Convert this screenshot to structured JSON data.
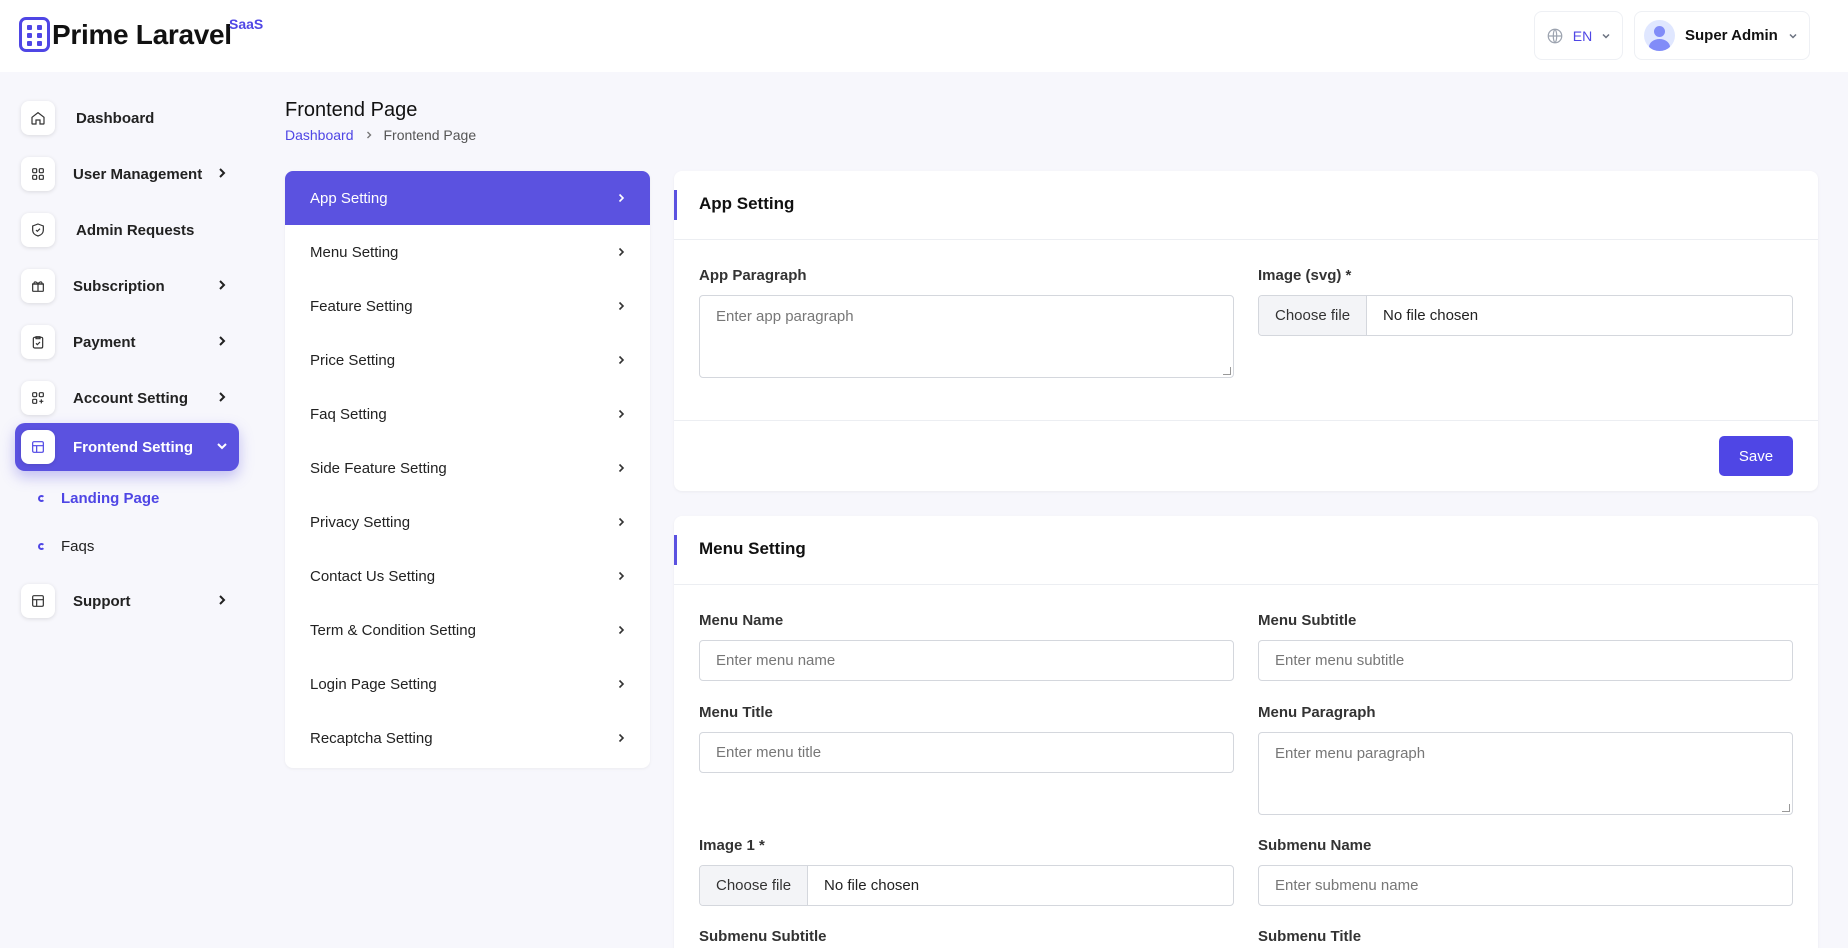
{
  "app": {
    "brand": "Prime Laravel",
    "brand_sup": "SaaS"
  },
  "header": {
    "language": "EN",
    "user_name": "Super Admin"
  },
  "sidebar": {
    "items": [
      {
        "label": "Dashboard",
        "icon": "home-icon"
      },
      {
        "label": "User Management",
        "icon": "grid-icon"
      },
      {
        "label": "Admin Requests",
        "icon": "shield-icon"
      },
      {
        "label": "Subscription",
        "icon": "gift-icon"
      },
      {
        "label": "Payment",
        "icon": "clipboard-icon"
      },
      {
        "label": "Account Setting",
        "icon": "apps-plus-icon"
      },
      {
        "label": "Frontend Setting",
        "icon": "layout-icon"
      },
      {
        "label": "Support",
        "icon": "layout-icon"
      }
    ],
    "sub_items": [
      "Landing Page",
      "Faqs"
    ]
  },
  "page": {
    "title": "Frontend Page",
    "breadcrumb": {
      "home": "Dashboard",
      "current": "Frontend Page"
    }
  },
  "settings_menu": [
    "App Setting",
    "Menu Setting",
    "Feature Setting",
    "Price Setting",
    "Faq Setting",
    "Side Feature Setting",
    "Privacy Setting",
    "Contact Us Setting",
    "Term & Condition Setting",
    "Login Page Setting",
    "Recaptcha Setting"
  ],
  "app_setting": {
    "title": "App Setting",
    "paragraph_label": "App Paragraph",
    "paragraph_placeholder": "Enter app paragraph",
    "image_label": "Image (svg) *",
    "choose_file": "Choose file",
    "no_file": "No file chosen",
    "save": "Save"
  },
  "menu_setting": {
    "title": "Menu Setting",
    "menu_name_label": "Menu Name",
    "menu_name_placeholder": "Enter menu name",
    "menu_subtitle_label": "Menu Subtitle",
    "menu_subtitle_placeholder": "Enter menu subtitle",
    "menu_title_label": "Menu Title",
    "menu_title_placeholder": "Enter menu title",
    "menu_paragraph_label": "Menu Paragraph",
    "menu_paragraph_placeholder": "Enter menu paragraph",
    "image1_label": "Image 1 *",
    "choose_file": "Choose file",
    "no_file": "No file chosen",
    "submenu_name_label": "Submenu Name",
    "submenu_name_placeholder": "Enter submenu name",
    "submenu_subtitle_label": "Submenu Subtitle",
    "submenu_title_label": "Submenu Title"
  },
  "colors": {
    "accent": "#5b52e0",
    "accent_dark": "#4f46e5",
    "background": "#f7f7fc"
  }
}
